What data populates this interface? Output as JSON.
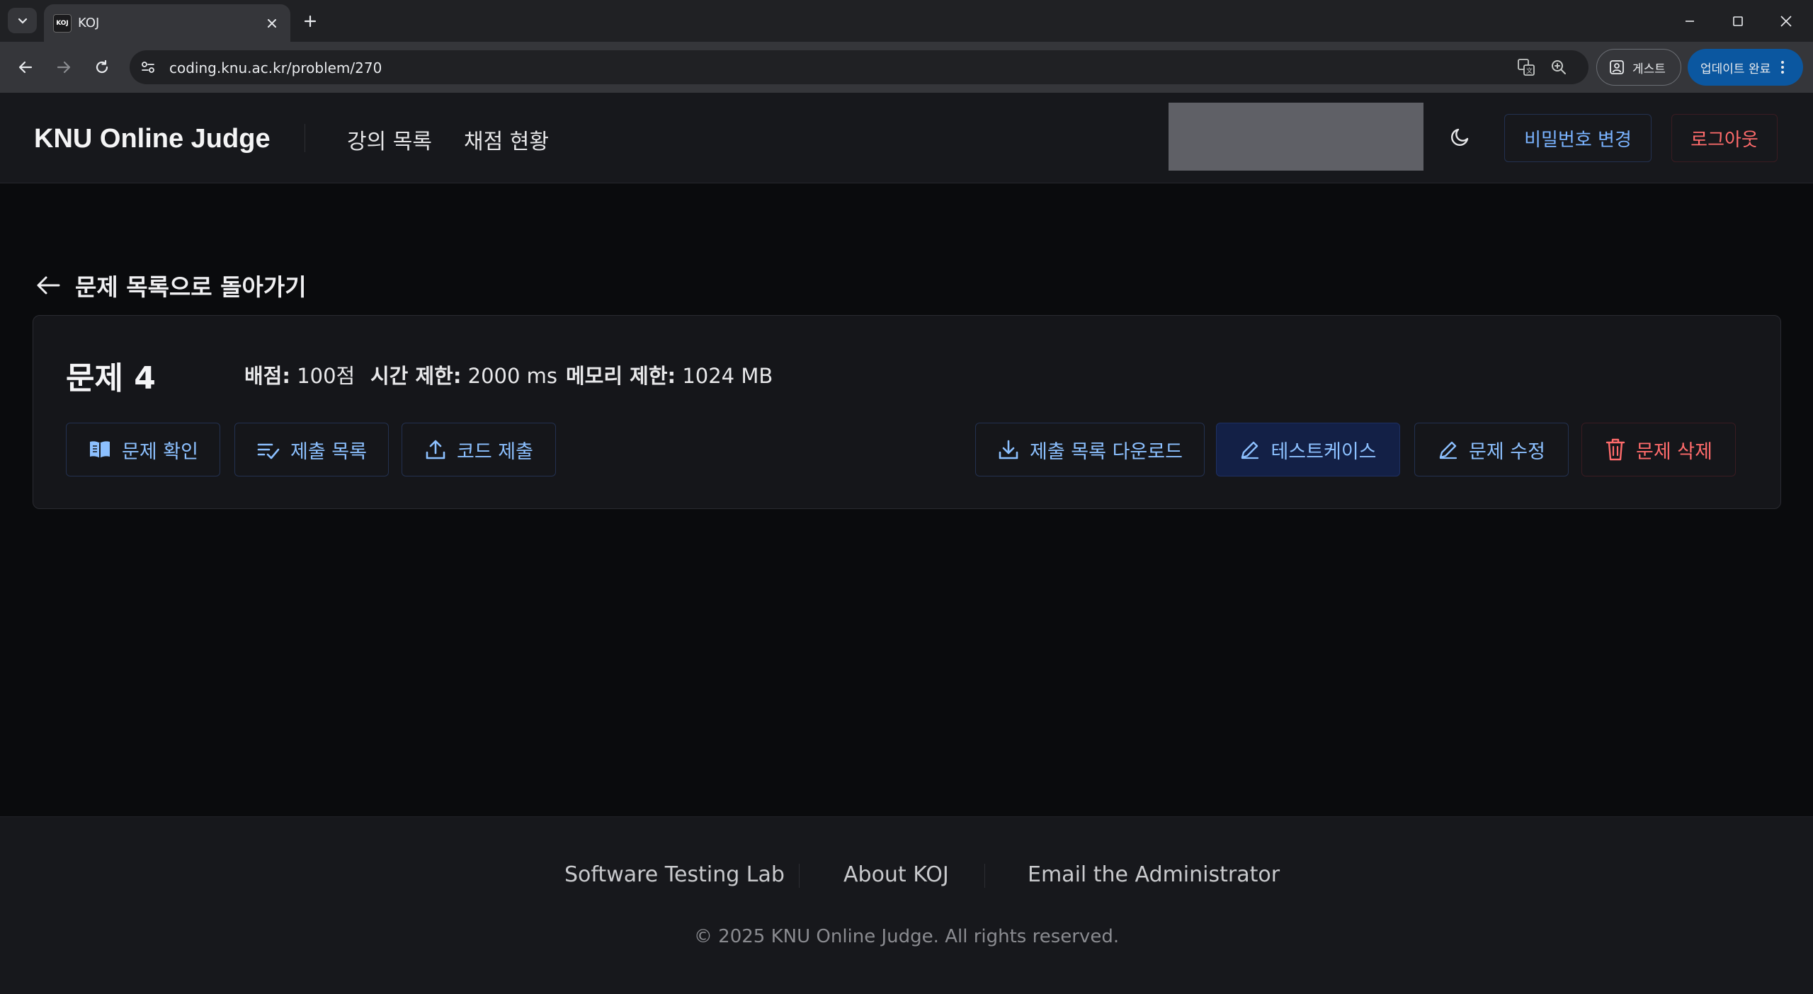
{
  "browser": {
    "tab_title": "KOJ",
    "favicon_text": "KOJ",
    "url": "coding.knu.ac.kr/problem/270",
    "profile_label": "게스트",
    "update_label": "업데이트 완료"
  },
  "header": {
    "brand": "KNU Online Judge",
    "nav": [
      "강의 목록",
      "채점 현황"
    ],
    "change_password": "비밀번호 변경",
    "logout": "로그아웃"
  },
  "page": {
    "back_label": "문제 목록으로 돌아가기",
    "problem_title": "문제 4",
    "score_label": "배점:",
    "score_value": "100점",
    "time_label": "시간 제한:",
    "time_value": "2000 ms",
    "memory_label": "메모리 제한:",
    "memory_value": "1024 MB",
    "buttons": {
      "view": "문제 확인",
      "submissions": "제출 목록",
      "submit": "코드 제출",
      "download": "제출 목록 다운로드",
      "testcases": "테스트케이스",
      "edit": "문제 수정",
      "delete": "문제 삭제"
    }
  },
  "footer": {
    "links": [
      "Software Testing Lab",
      "About KOJ",
      "Email the Administrator"
    ],
    "copyright": "© 2025 KNU Online Judge. All rights reserved."
  },
  "colors": {
    "accent_blue": "#7ab3ff",
    "danger_red": "#ff6b6b",
    "background": "#0a0b0d"
  }
}
